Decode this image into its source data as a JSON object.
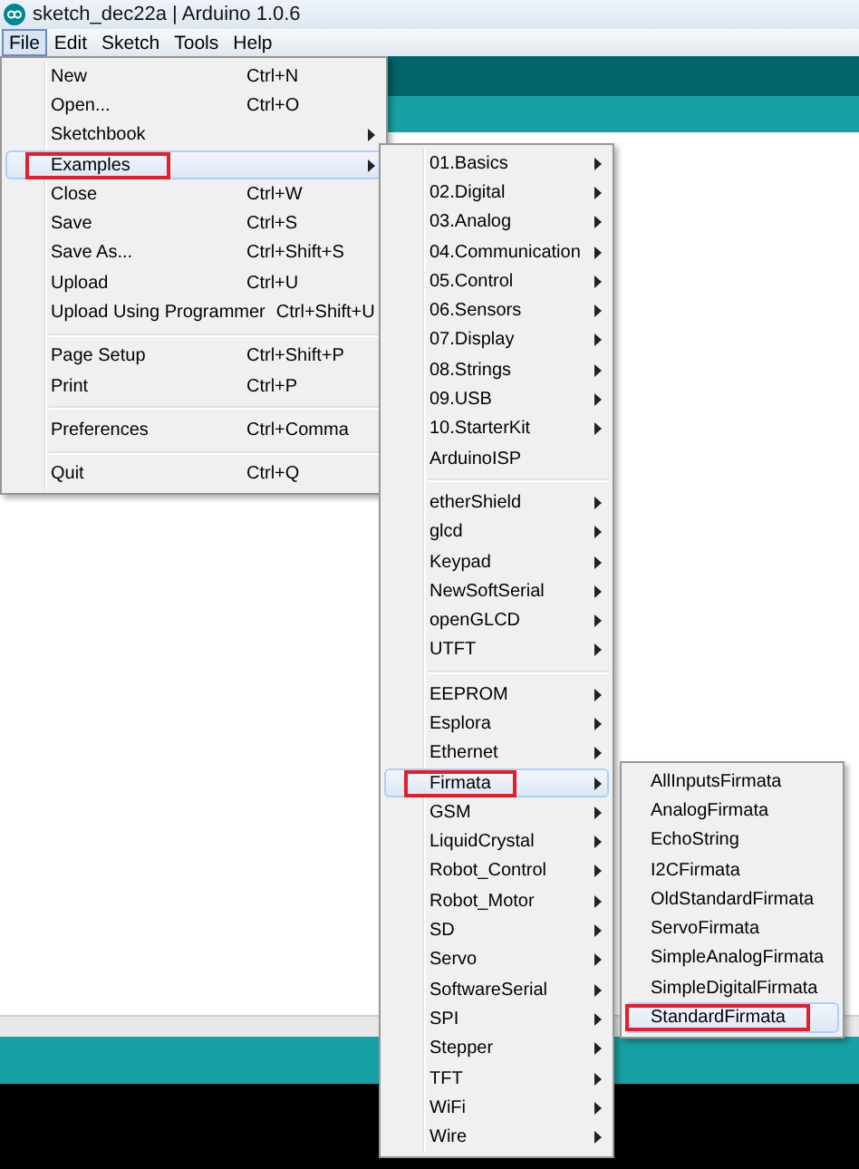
{
  "window": {
    "title": "sketch_dec22a | Arduino 1.0.6"
  },
  "menu_bar": [
    {
      "label": "File",
      "selected": true
    },
    {
      "label": "Edit",
      "selected": false
    },
    {
      "label": "Sketch",
      "selected": false
    },
    {
      "label": "Tools",
      "selected": false
    },
    {
      "label": "Help",
      "selected": false
    }
  ],
  "file_menu": [
    {
      "kind": "item",
      "label": "New",
      "shortcut": "Ctrl+N",
      "selected": false
    },
    {
      "kind": "item",
      "label": "Open...",
      "shortcut": "Ctrl+O",
      "selected": false
    },
    {
      "kind": "submenu",
      "label": "Sketchbook",
      "selected": false
    },
    {
      "kind": "submenu",
      "label": "Examples",
      "selected": true
    },
    {
      "kind": "item",
      "label": "Close",
      "shortcut": "Ctrl+W",
      "selected": false
    },
    {
      "kind": "item",
      "label": "Save",
      "shortcut": "Ctrl+S",
      "selected": false
    },
    {
      "kind": "item",
      "label": "Save As...",
      "shortcut": "Ctrl+Shift+S",
      "selected": false
    },
    {
      "kind": "item",
      "label": "Upload",
      "shortcut": "Ctrl+U",
      "selected": false
    },
    {
      "kind": "item",
      "label": "Upload Using Programmer",
      "shortcut": "Ctrl+Shift+U",
      "selected": false
    },
    {
      "kind": "separator"
    },
    {
      "kind": "item",
      "label": "Page Setup",
      "shortcut": "Ctrl+Shift+P",
      "selected": false
    },
    {
      "kind": "item",
      "label": "Print",
      "shortcut": "Ctrl+P",
      "selected": false
    },
    {
      "kind": "separator"
    },
    {
      "kind": "item",
      "label": "Preferences",
      "shortcut": "Ctrl+Comma",
      "selected": false
    },
    {
      "kind": "separator"
    },
    {
      "kind": "item",
      "label": "Quit",
      "shortcut": "Ctrl+Q",
      "selected": false
    }
  ],
  "examples_menu": [
    {
      "kind": "submenu",
      "label": "01.Basics",
      "selected": false
    },
    {
      "kind": "submenu",
      "label": "02.Digital",
      "selected": false
    },
    {
      "kind": "submenu",
      "label": "03.Analog",
      "selected": false
    },
    {
      "kind": "submenu",
      "label": "04.Communication",
      "selected": false
    },
    {
      "kind": "submenu",
      "label": "05.Control",
      "selected": false
    },
    {
      "kind": "submenu",
      "label": "06.Sensors",
      "selected": false
    },
    {
      "kind": "submenu",
      "label": "07.Display",
      "selected": false
    },
    {
      "kind": "submenu",
      "label": "08.Strings",
      "selected": false
    },
    {
      "kind": "submenu",
      "label": "09.USB",
      "selected": false
    },
    {
      "kind": "submenu",
      "label": "10.StarterKit",
      "selected": false
    },
    {
      "kind": "item",
      "label": "ArduinoISP",
      "selected": false
    },
    {
      "kind": "separator"
    },
    {
      "kind": "submenu",
      "label": "etherShield",
      "selected": false
    },
    {
      "kind": "submenu",
      "label": "glcd",
      "selected": false
    },
    {
      "kind": "submenu",
      "label": "Keypad",
      "selected": false
    },
    {
      "kind": "submenu",
      "label": "NewSoftSerial",
      "selected": false
    },
    {
      "kind": "submenu",
      "label": "openGLCD",
      "selected": false
    },
    {
      "kind": "submenu",
      "label": "UTFT",
      "selected": false
    },
    {
      "kind": "separator"
    },
    {
      "kind": "submenu",
      "label": "EEPROM",
      "selected": false
    },
    {
      "kind": "submenu",
      "label": "Esplora",
      "selected": false
    },
    {
      "kind": "submenu",
      "label": "Ethernet",
      "selected": false
    },
    {
      "kind": "submenu",
      "label": "Firmata",
      "selected": true
    },
    {
      "kind": "submenu",
      "label": "GSM",
      "selected": false
    },
    {
      "kind": "submenu",
      "label": "LiquidCrystal",
      "selected": false
    },
    {
      "kind": "submenu",
      "label": "Robot_Control",
      "selected": false
    },
    {
      "kind": "submenu",
      "label": "Robot_Motor",
      "selected": false
    },
    {
      "kind": "submenu",
      "label": "SD",
      "selected": false
    },
    {
      "kind": "submenu",
      "label": "Servo",
      "selected": false
    },
    {
      "kind": "submenu",
      "label": "SoftwareSerial",
      "selected": false
    },
    {
      "kind": "submenu",
      "label": "SPI",
      "selected": false
    },
    {
      "kind": "submenu",
      "label": "Stepper",
      "selected": false
    },
    {
      "kind": "submenu",
      "label": "TFT",
      "selected": false
    },
    {
      "kind": "submenu",
      "label": "WiFi",
      "selected": false
    },
    {
      "kind": "submenu",
      "label": "Wire",
      "selected": false
    }
  ],
  "firmata_menu": [
    {
      "kind": "item",
      "label": "AllInputsFirmata",
      "selected": false
    },
    {
      "kind": "item",
      "label": "AnalogFirmata",
      "selected": false
    },
    {
      "kind": "item",
      "label": "EchoString",
      "selected": false
    },
    {
      "kind": "item",
      "label": "I2CFirmata",
      "selected": false
    },
    {
      "kind": "item",
      "label": "OldStandardFirmata",
      "selected": false
    },
    {
      "kind": "item",
      "label": "ServoFirmata",
      "selected": false
    },
    {
      "kind": "item",
      "label": "SimpleAnalogFirmata",
      "selected": false
    },
    {
      "kind": "item",
      "label": "SimpleDigitalFirmata",
      "selected": false
    },
    {
      "kind": "item",
      "label": "StandardFirmata",
      "selected": true
    }
  ]
}
